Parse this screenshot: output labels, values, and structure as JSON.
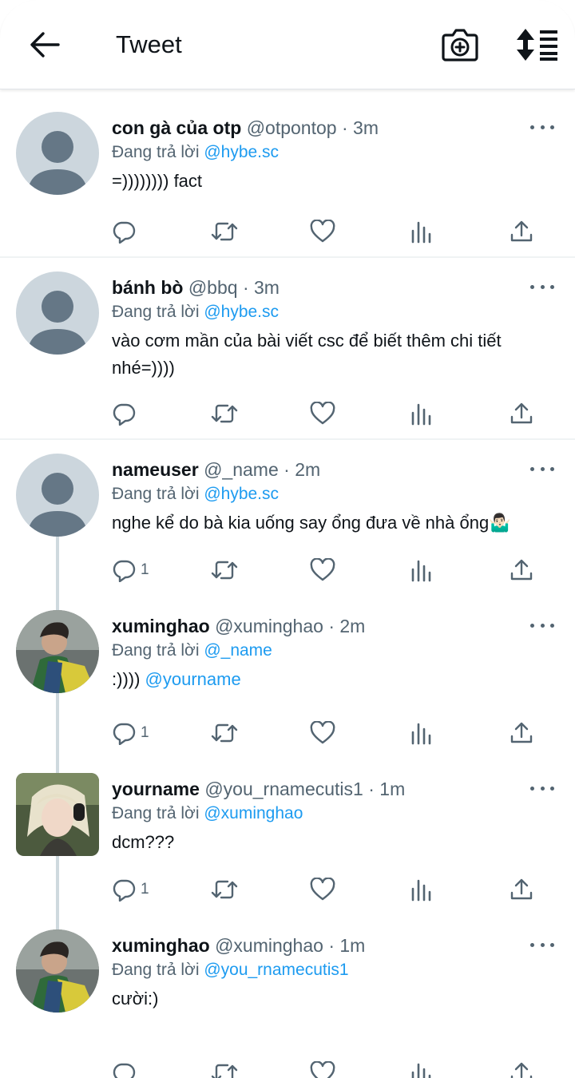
{
  "header": {
    "title": "Tweet"
  },
  "tweets": [
    {
      "name": "con gà của otp",
      "handle": "@otpontop",
      "sep": "·",
      "time": "3m",
      "reply_prefix": "Đang trả lời",
      "reply_to": "@hybe.sc",
      "text": "=)))))))) fact",
      "text_mention": "",
      "replies": ""
    },
    {
      "name": "bánh bò",
      "handle": "@bbq",
      "sep": "·",
      "time": "3m",
      "reply_prefix": "Đang trả lời",
      "reply_to": "@hybe.sc",
      "text": "vào cơm mần của bài viết csc để biết thêm chi tiết nhé=))))",
      "text_mention": "",
      "replies": ""
    },
    {
      "name": "nameuser",
      "handle": " @_name",
      "sep": "·",
      "time": "2m",
      "reply_prefix": "Đang trả lời",
      "reply_to": "@hybe.sc",
      "text": "nghe kể do bà kia uống say ổng đưa về nhà ổng🤷🏻‍♂️",
      "text_mention": "",
      "replies": "1"
    },
    {
      "name": "xuminghao",
      "handle": "@xuminghao",
      "sep": "·",
      "time": "2m",
      "reply_prefix": "Đang trả lời",
      "reply_to": "@_name",
      "text": ":)))) ",
      "text_mention": "@yourname",
      "replies": "1"
    },
    {
      "name": "yourname",
      "handle": "@you_rnamecutis1",
      "sep": "·",
      "time": "1m",
      "reply_prefix": "Đang trả lời",
      "reply_to": "@xuminghao",
      "text": "dcm???",
      "text_mention": "",
      "replies": "1"
    },
    {
      "name": "xuminghao",
      "handle": "@xuminghao",
      "sep": "·",
      "time": "1m",
      "reply_prefix": "Đang trả lời",
      "reply_to": "@you_rnamecutis1",
      "text": "cười:)",
      "text_mention": "",
      "replies": ""
    }
  ],
  "colors": {
    "accent": "#1d9bf0",
    "secondary_text": "#536471",
    "thread_line": "#cfd9de"
  }
}
